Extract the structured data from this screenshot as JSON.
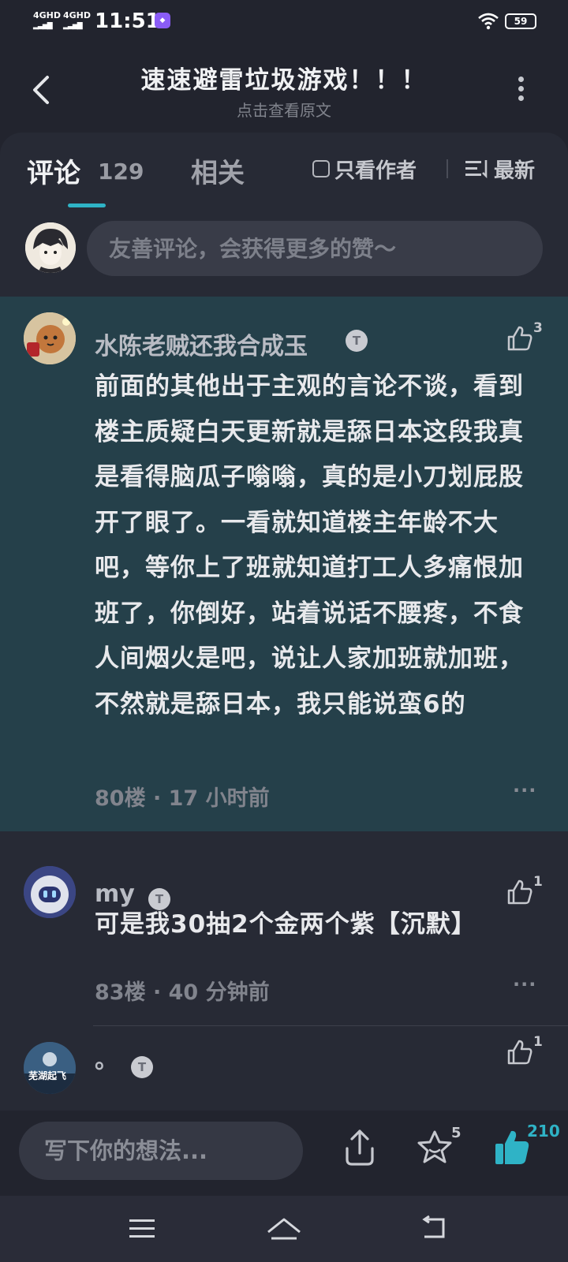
{
  "status_bar": {
    "signal_1": "4GHD",
    "signal_2": "4GHD",
    "time": "11:51",
    "battery": "59"
  },
  "header": {
    "title": "速速避雷垃圾游戏！！！",
    "subtitle": "点击查看原文"
  },
  "tabs": {
    "comments_label": "评论",
    "comments_count": "129",
    "related_label": "相关",
    "author_only_label": "只看作者",
    "sort_label": "最新"
  },
  "compose": {
    "placeholder": "友善评论，会获得更多的赞～"
  },
  "comments": [
    {
      "name": "水陈老贼还我合成玉",
      "badge": "T",
      "likes": "3",
      "body": "前面的其他出于主观的言论不谈，看到楼主质疑白天更新就是舔日本这段我真是看得脑瓜子嗡嗡，真的是小刀划屁股开了眼了。一看就知道楼主年龄不大吧，等你上了班就知道打工人多痛恨加班了，你倒好，站着说话不腰疼，不食人间烟火是吧，说让人家加班就加班，不然就是舔日本，我只能说蛮6的",
      "meta": "80楼 · 17 小时前",
      "more": "···"
    },
    {
      "name": "my",
      "badge": "T",
      "likes": "1",
      "body": "可是我30抽2个金两个紫【沉默】",
      "meta": "83楼 · 40 分钟前",
      "more": "···"
    },
    {
      "name": "。",
      "badge": "T",
      "likes": "1",
      "avatar_text": "芜湖起飞"
    }
  ],
  "bottom_bar": {
    "reply_placeholder": "写下你的想法...",
    "favorite_count": "5",
    "like_count": "210"
  },
  "colors": {
    "accent": "#2fb3c6",
    "background": "#22242e",
    "highlight": "#25404a"
  }
}
